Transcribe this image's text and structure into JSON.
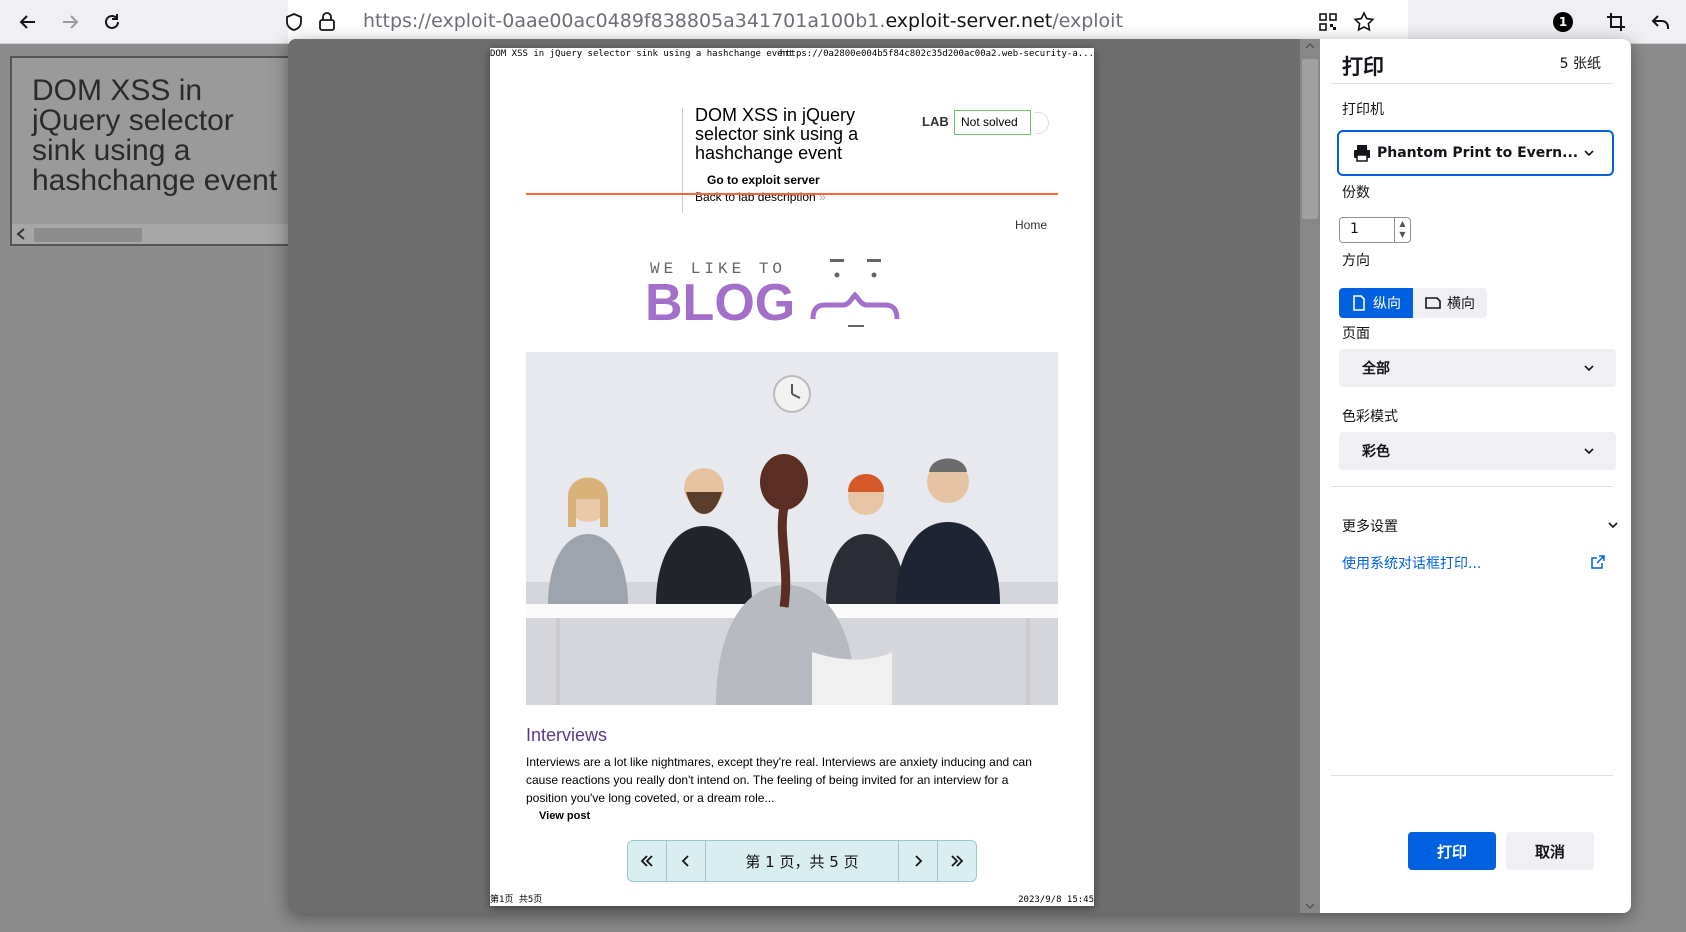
{
  "browser": {
    "url_prefix": "https://exploit-0aae00ac0489f838805a341701a100b1.",
    "url_domain": "exploit-server.net",
    "url_path": "/exploit",
    "extension_badge": "1"
  },
  "background_page": {
    "title": "DOM XSS in jQuery selector sink using a hashchange event"
  },
  "preview": {
    "header_left": "DOM XSS in jQuery selector sink using a hashchange event",
    "header_right": "https://0a2800e004b5f84c802c35d200ac00a2.web-security-a...",
    "lab_title": "DOM XSS in jQuery selector sink using a hashchange event",
    "lab_label": "LAB",
    "lab_status": "Not solved",
    "exploit_link": "Go to exploit server",
    "back_link": "Back to lab description",
    "home_link": "Home",
    "logo_top": "WE LIKE TO",
    "logo_main": "BLOG",
    "post_title": "Interviews",
    "post_body": "Interviews are a lot like nightmares, except they're real. Interviews are anxiety inducing and can cause reactions you really don't intend on. The feeling of being invited for an interview for a position you've long coveted, or a dream role...",
    "view_post": "View post",
    "footer_left": "第1页 共5页",
    "footer_right": "2023/9/8 15:45"
  },
  "page_nav": {
    "text": "第 1 页，共 5 页"
  },
  "print_panel": {
    "title": "打印",
    "sheets": "5 张纸",
    "printer_label": "打印机",
    "printer_value": "Phantom Print to Evern...",
    "copies_label": "份数",
    "copies_value": "1",
    "orientation_label": "方向",
    "portrait": "纵向",
    "landscape": "横向",
    "pages_label": "页面",
    "pages_value": "全部",
    "color_label": "色彩模式",
    "color_value": "彩色",
    "more_settings": "更多设置",
    "system_dialog": "使用系统对话框打印...",
    "print_button": "打印",
    "cancel_button": "取消"
  },
  "colors": {
    "accent": "#0061e0",
    "lab_border": "#70c070",
    "header_line": "#ff6633",
    "blog_purple": "#a36fc8"
  }
}
